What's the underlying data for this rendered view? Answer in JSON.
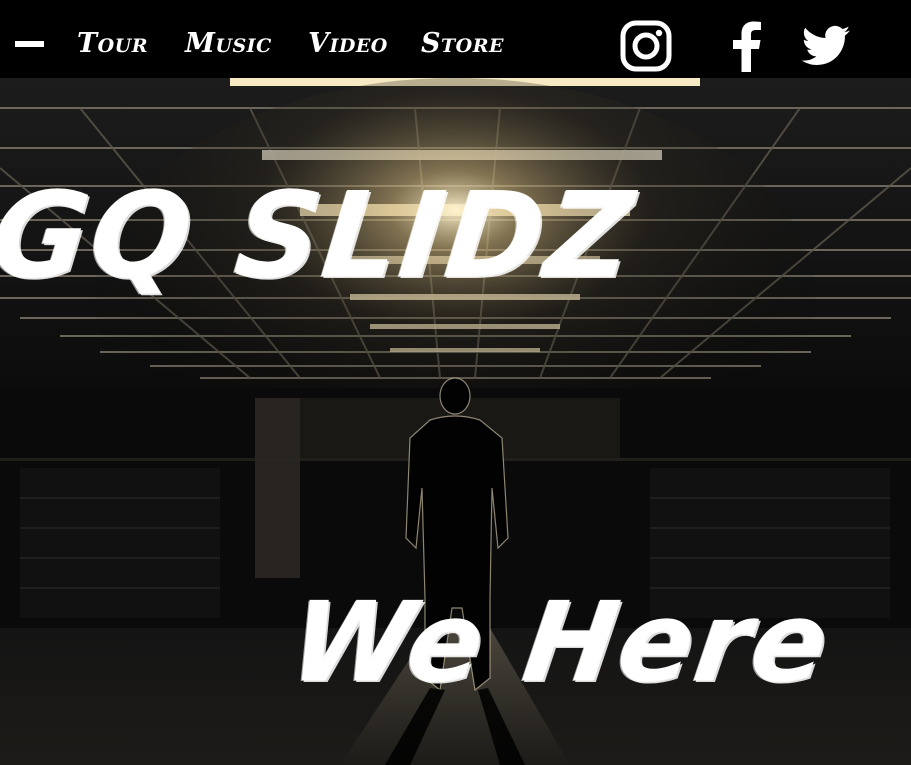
{
  "nav": {
    "menu_icon": "menu-dash-icon",
    "links": [
      {
        "label": "Tour"
      },
      {
        "label": "Music"
      },
      {
        "label": "Video"
      },
      {
        "label": "Store"
      }
    ],
    "social": [
      {
        "icon": "instagram-icon"
      },
      {
        "icon": "facebook-icon"
      },
      {
        "icon": "twitter-icon"
      }
    ]
  },
  "hero": {
    "title": "GQ SLIDZ",
    "subtitle": "We Here",
    "image_alt": "Silhouette of a man standing in a dark parking garage under ceiling lights"
  },
  "colors": {
    "nav_bg": "#000000",
    "text": "#ffffff",
    "light_glow": "#f3d9a0"
  }
}
